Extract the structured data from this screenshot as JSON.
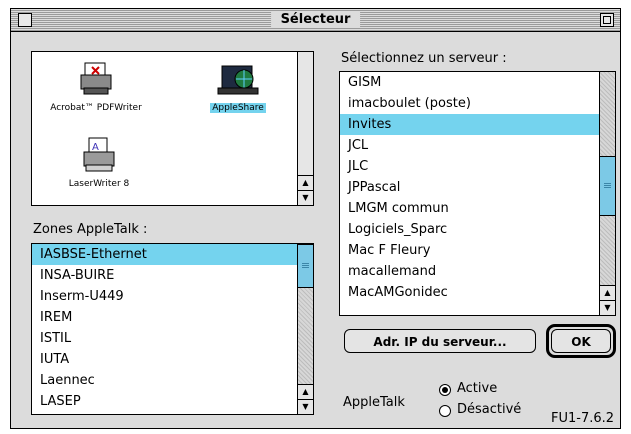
{
  "window": {
    "title": "Sélecteur"
  },
  "devices": [
    {
      "label": "Acrobat™ PDFWriter",
      "selected": false
    },
    {
      "label": "AppleShare",
      "selected": true
    },
    {
      "label": "LaserWriter 8",
      "selected": false
    }
  ],
  "zones": {
    "label": "Zones AppleTalk :",
    "items": [
      "IASBSE-Ethernet",
      "INSA-BUIRE",
      "Inserm-U449",
      "IREM",
      "ISTIL",
      "IUTA",
      "Laennec",
      "LASEP"
    ],
    "selected_index": 0,
    "scroll_position": 0.0
  },
  "servers": {
    "label": "Sélectionnez un serveur :",
    "items": [
      "GISM",
      "imacboulet (poste)",
      "Invites",
      "JCL",
      "JLC",
      "JPPascal",
      "LMGM commun",
      "Logiciels_Sparc",
      "Mac F Fleury",
      "macallemand",
      "MacAMGonidec"
    ],
    "selected_index": 2,
    "scroll_position": 0.55
  },
  "buttons": {
    "ip": "Adr. IP du serveur...",
    "ok": "OK"
  },
  "appletalk": {
    "label": "AppleTalk",
    "active": "Active",
    "inactive": "Désactivé",
    "selected": "Active"
  },
  "version": "FU1-7.6.2",
  "colors": {
    "selection": "#74d3ee"
  }
}
